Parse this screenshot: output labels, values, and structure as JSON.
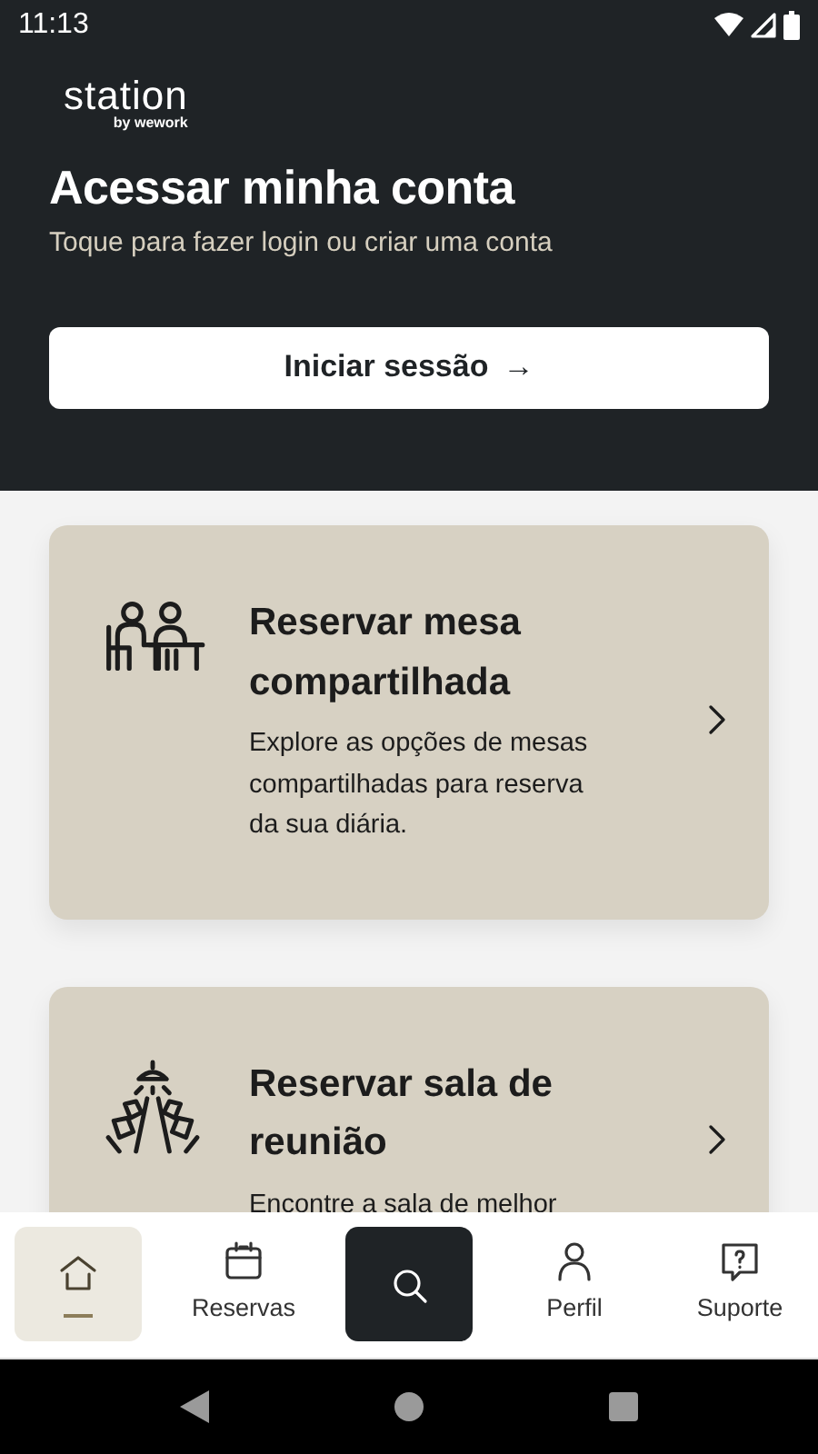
{
  "status_bar": {
    "time": "11:13"
  },
  "header": {
    "logo": {
      "name": "station",
      "byline": "by wework"
    },
    "title": "Acessar minha conta",
    "subtitle": "Toque para fazer login ou criar uma conta",
    "button": "Iniciar sessão",
    "button_arrow": "→"
  },
  "cards": [
    {
      "title": "Reservar mesa compartilhada",
      "description": "Explore as opções de mesas compartilhadas para reserva da sua diária."
    },
    {
      "title": "Reservar sala de reunião",
      "description": "Encontre a sala de melhor"
    }
  ],
  "bottom_nav": [
    {
      "kind": "tab",
      "selected": true
    },
    {
      "label": "Reservas",
      "kind": "tab",
      "selected": false
    },
    {
      "kind": "action",
      "selected": false
    },
    {
      "label": "Perfil",
      "kind": "tab",
      "selected": false
    },
    {
      "label": "Suporte",
      "kind": "tab",
      "selected": false
    }
  ]
}
